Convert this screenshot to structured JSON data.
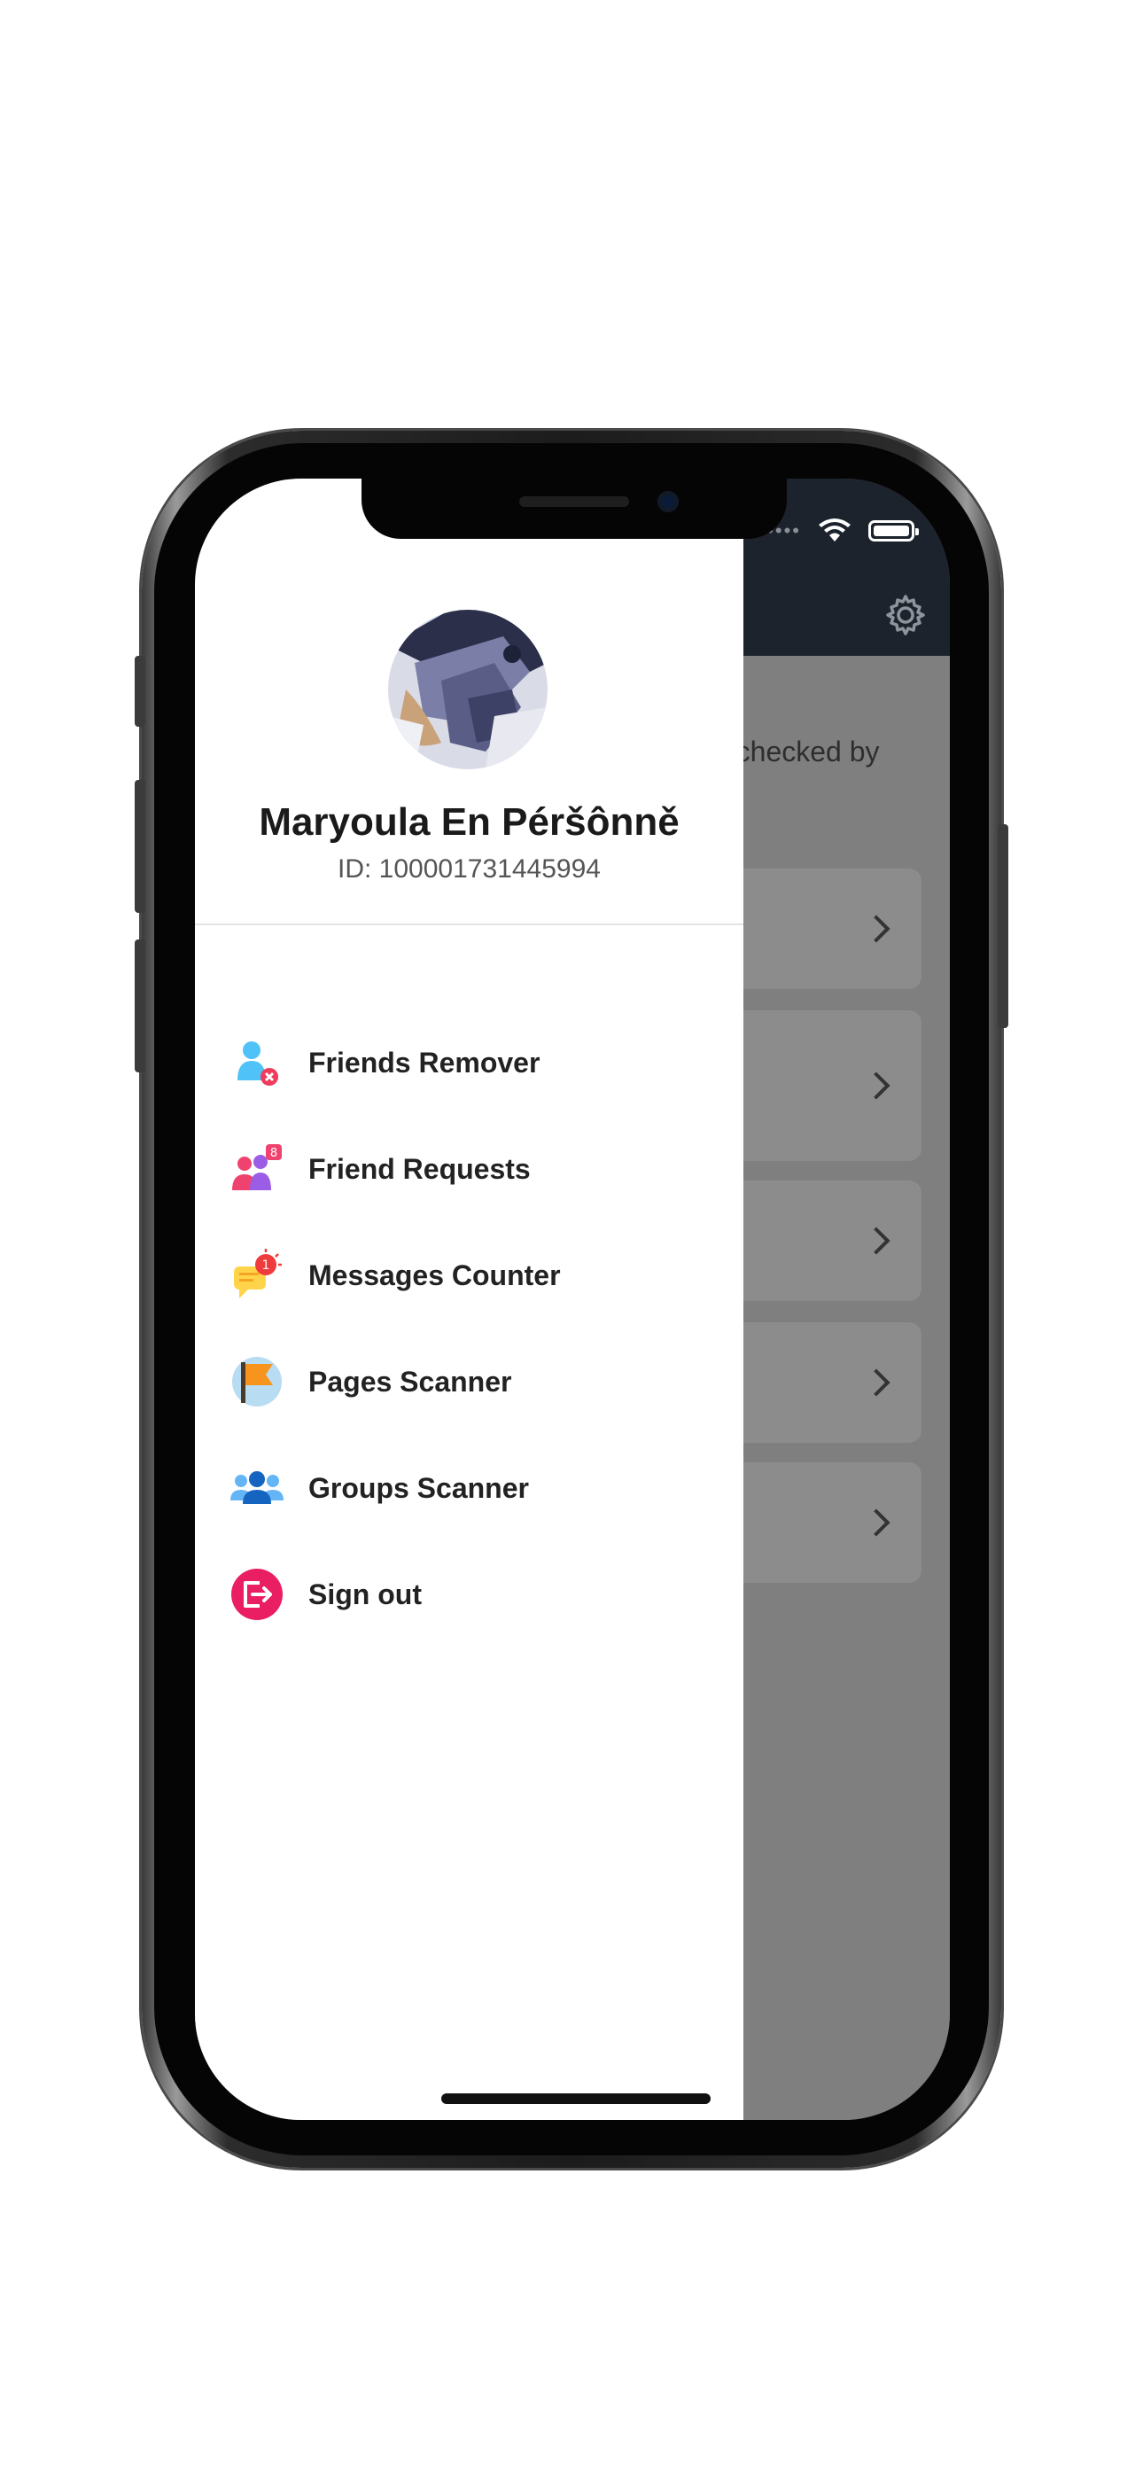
{
  "drawer": {
    "profile": {
      "name": "Maryoula En Péršônně",
      "id_text": "ID: 100001731445994"
    },
    "menu": [
      {
        "label": "Friends Remover",
        "icon": "friend-remove-icon"
      },
      {
        "label": "Friend Requests",
        "icon": "friend-requests-icon",
        "badge": "8"
      },
      {
        "label": "Messages Counter",
        "icon": "messages-counter-icon",
        "badge": "1"
      },
      {
        "label": "Pages Scanner",
        "icon": "flag-icon"
      },
      {
        "label": "Groups Scanner",
        "icon": "groups-icon"
      },
      {
        "label": "Sign out",
        "icon": "sign-out-icon"
      }
    ]
  },
  "background": {
    "partial_text": "(checked by"
  },
  "colors": {
    "header_dark": "#1c232c",
    "overlay_gray": "#7f7f7f",
    "sign_out": "#e91e63",
    "friend_blue": "#4fc3f7"
  }
}
